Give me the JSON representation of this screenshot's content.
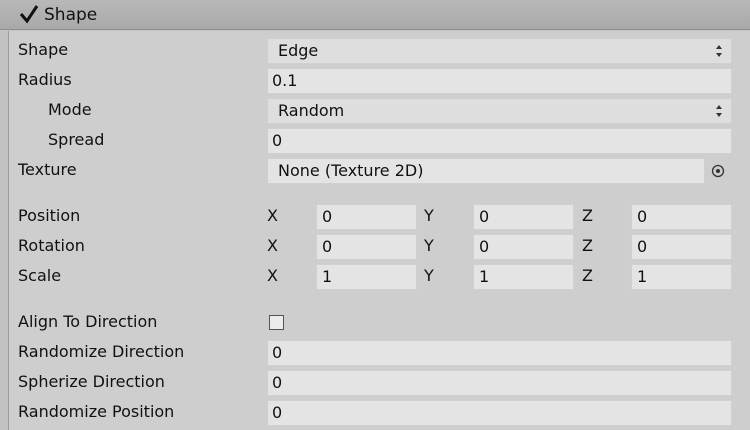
{
  "header": {
    "title": "Shape",
    "enabled": true
  },
  "shape": {
    "label": "Shape",
    "value": "Edge"
  },
  "radius": {
    "label": "Radius",
    "value": "0.1"
  },
  "mode": {
    "label": "Mode",
    "value": "Random"
  },
  "spread": {
    "label": "Spread",
    "value": "0"
  },
  "texture": {
    "label": "Texture",
    "value": "None (Texture 2D)"
  },
  "axis_labels": {
    "x": "X",
    "y": "Y",
    "z": "Z"
  },
  "position": {
    "label": "Position",
    "x": "0",
    "y": "0",
    "z": "0"
  },
  "rotation": {
    "label": "Rotation",
    "x": "0",
    "y": "0",
    "z": "0"
  },
  "scale": {
    "label": "Scale",
    "x": "1",
    "y": "1",
    "z": "1"
  },
  "align_to_direction": {
    "label": "Align To Direction",
    "checked": false
  },
  "randomize_direction": {
    "label": "Randomize Direction",
    "value": "0"
  },
  "spherize_direction": {
    "label": "Spherize Direction",
    "value": "0"
  },
  "randomize_position": {
    "label": "Randomize Position",
    "value": "0"
  }
}
